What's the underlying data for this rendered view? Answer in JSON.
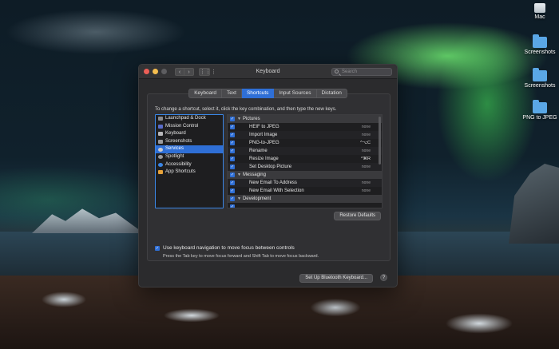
{
  "window": {
    "title": "Keyboard",
    "search_placeholder": "Search",
    "back_glyph": "‹",
    "forward_glyph": "›",
    "grid_glyph": "⋮⋮⋮"
  },
  "tabs": [
    {
      "label": "Keyboard",
      "active": false
    },
    {
      "label": "Text",
      "active": false
    },
    {
      "label": "Shortcuts",
      "active": true
    },
    {
      "label": "Input Sources",
      "active": false
    },
    {
      "label": "Dictation",
      "active": false
    }
  ],
  "instruction": "To change a shortcut, select it, click the key combination, and then type the new keys.",
  "categories": [
    {
      "label": "Launchpad & Dock",
      "icon": "launchpad-icon",
      "color": "#8a8a8d"
    },
    {
      "label": "Mission Control",
      "icon": "mission-control-icon",
      "color": "#5a6cc8"
    },
    {
      "label": "Keyboard",
      "icon": "keyboard-icon",
      "color": "#b8b8bb"
    },
    {
      "label": "Screenshots",
      "icon": "screenshots-icon",
      "color": "#9a9a9d"
    },
    {
      "label": "Services",
      "icon": "gear-icon",
      "color": "#c9c9cc",
      "selected": true
    },
    {
      "label": "Spotlight",
      "icon": "spotlight-icon",
      "color": "#9a9a9d"
    },
    {
      "label": "Accessibility",
      "icon": "accessibility-icon",
      "color": "#3a86e6"
    },
    {
      "label": "App Shortcuts",
      "icon": "app-shortcuts-icon",
      "color": "#e6a23a"
    }
  ],
  "shortcuts": [
    {
      "type": "group",
      "name": "Pictures",
      "checked": true
    },
    {
      "type": "item",
      "name": "HEIF to JPEG",
      "key": "none",
      "checked": true
    },
    {
      "type": "item",
      "name": "Import Image",
      "key": "none",
      "checked": true
    },
    {
      "type": "item",
      "name": "PNG-to-JPEG",
      "key": "^⌥C",
      "checked": true
    },
    {
      "type": "item",
      "name": "Rename",
      "key": "none",
      "checked": true
    },
    {
      "type": "item",
      "name": "Resize Image",
      "key": "^⌘R",
      "checked": true
    },
    {
      "type": "item",
      "name": "Set Desktop Picture",
      "key": "none",
      "checked": true
    },
    {
      "type": "group",
      "name": "Messaging",
      "checked": true
    },
    {
      "type": "item",
      "name": "New Email To Address",
      "key": "none",
      "checked": true
    },
    {
      "type": "item",
      "name": "New Email With Selection",
      "key": "none",
      "checked": true
    },
    {
      "type": "group",
      "name": "Development",
      "checked": true
    },
    {
      "type": "item",
      "name": "",
      "key": "",
      "checked": true
    }
  ],
  "restore_defaults": "Restore Defaults",
  "keyboard_nav": {
    "label": "Use keyboard navigation to move focus between controls",
    "hint": "Press the Tab key to move focus forward and Shift Tab to move focus backward.",
    "checked": true
  },
  "bluetooth_button": "Set Up Bluetooth Keyboard...",
  "help_glyph": "?",
  "desktop_icons": [
    {
      "label": "Mac",
      "kind": "drive"
    },
    {
      "label": "Screenshots",
      "kind": "folder"
    },
    {
      "label": "Screenshots",
      "kind": "folder"
    },
    {
      "label": "PNG to JPEG",
      "kind": "folder"
    }
  ],
  "colors": {
    "accent": "#2f6fd6",
    "window_bg": "#2b2b2d"
  }
}
